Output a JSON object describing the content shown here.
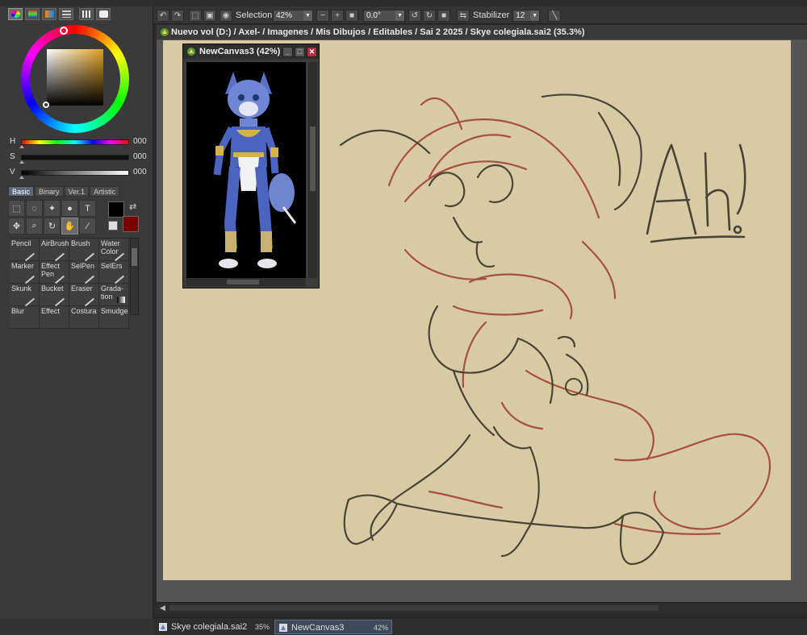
{
  "left_panel": {
    "sliders": [
      {
        "label": "H",
        "value": "000"
      },
      {
        "label": "S",
        "value": "000"
      },
      {
        "label": "V",
        "value": "000"
      }
    ],
    "tool_tabs": [
      "Basic",
      "Binary",
      "Ver.1",
      "Artistic"
    ],
    "brushes": [
      "Pencil",
      "AirBrush",
      "Brush",
      "Water Color",
      "Marker",
      "Effect Pen",
      "SelPen",
      "SelErs",
      "Skunk",
      "Bucket",
      "Eraser",
      "Grada-tion",
      "Blur",
      "Effect",
      "Costura",
      "Smudge"
    ],
    "colors": {
      "foreground": "#000000",
      "background": "#7a0000"
    }
  },
  "toolbar": {
    "selection_label": "Selection",
    "zoom": "42%",
    "rotation": "0.0°",
    "stabilizer_label": "Stabilizer",
    "stabilizer_value": "12"
  },
  "document": {
    "title": "Nuevo vol (D:) / Axel- / Imagenes / Mis Dibujos / Editables / Sai 2 2025 / Skye colegiala.sai2 (35.3%)",
    "canvas_text": "Ah!",
    "canvas_bg": "#d8cba3"
  },
  "float_window": {
    "title": "NewCanvas3 (42%)"
  },
  "bottom_tabs": [
    {
      "name": "Skye colegiala.sai2",
      "zoom": "35%"
    },
    {
      "name": "NewCanvas3",
      "zoom": "42%"
    }
  ]
}
